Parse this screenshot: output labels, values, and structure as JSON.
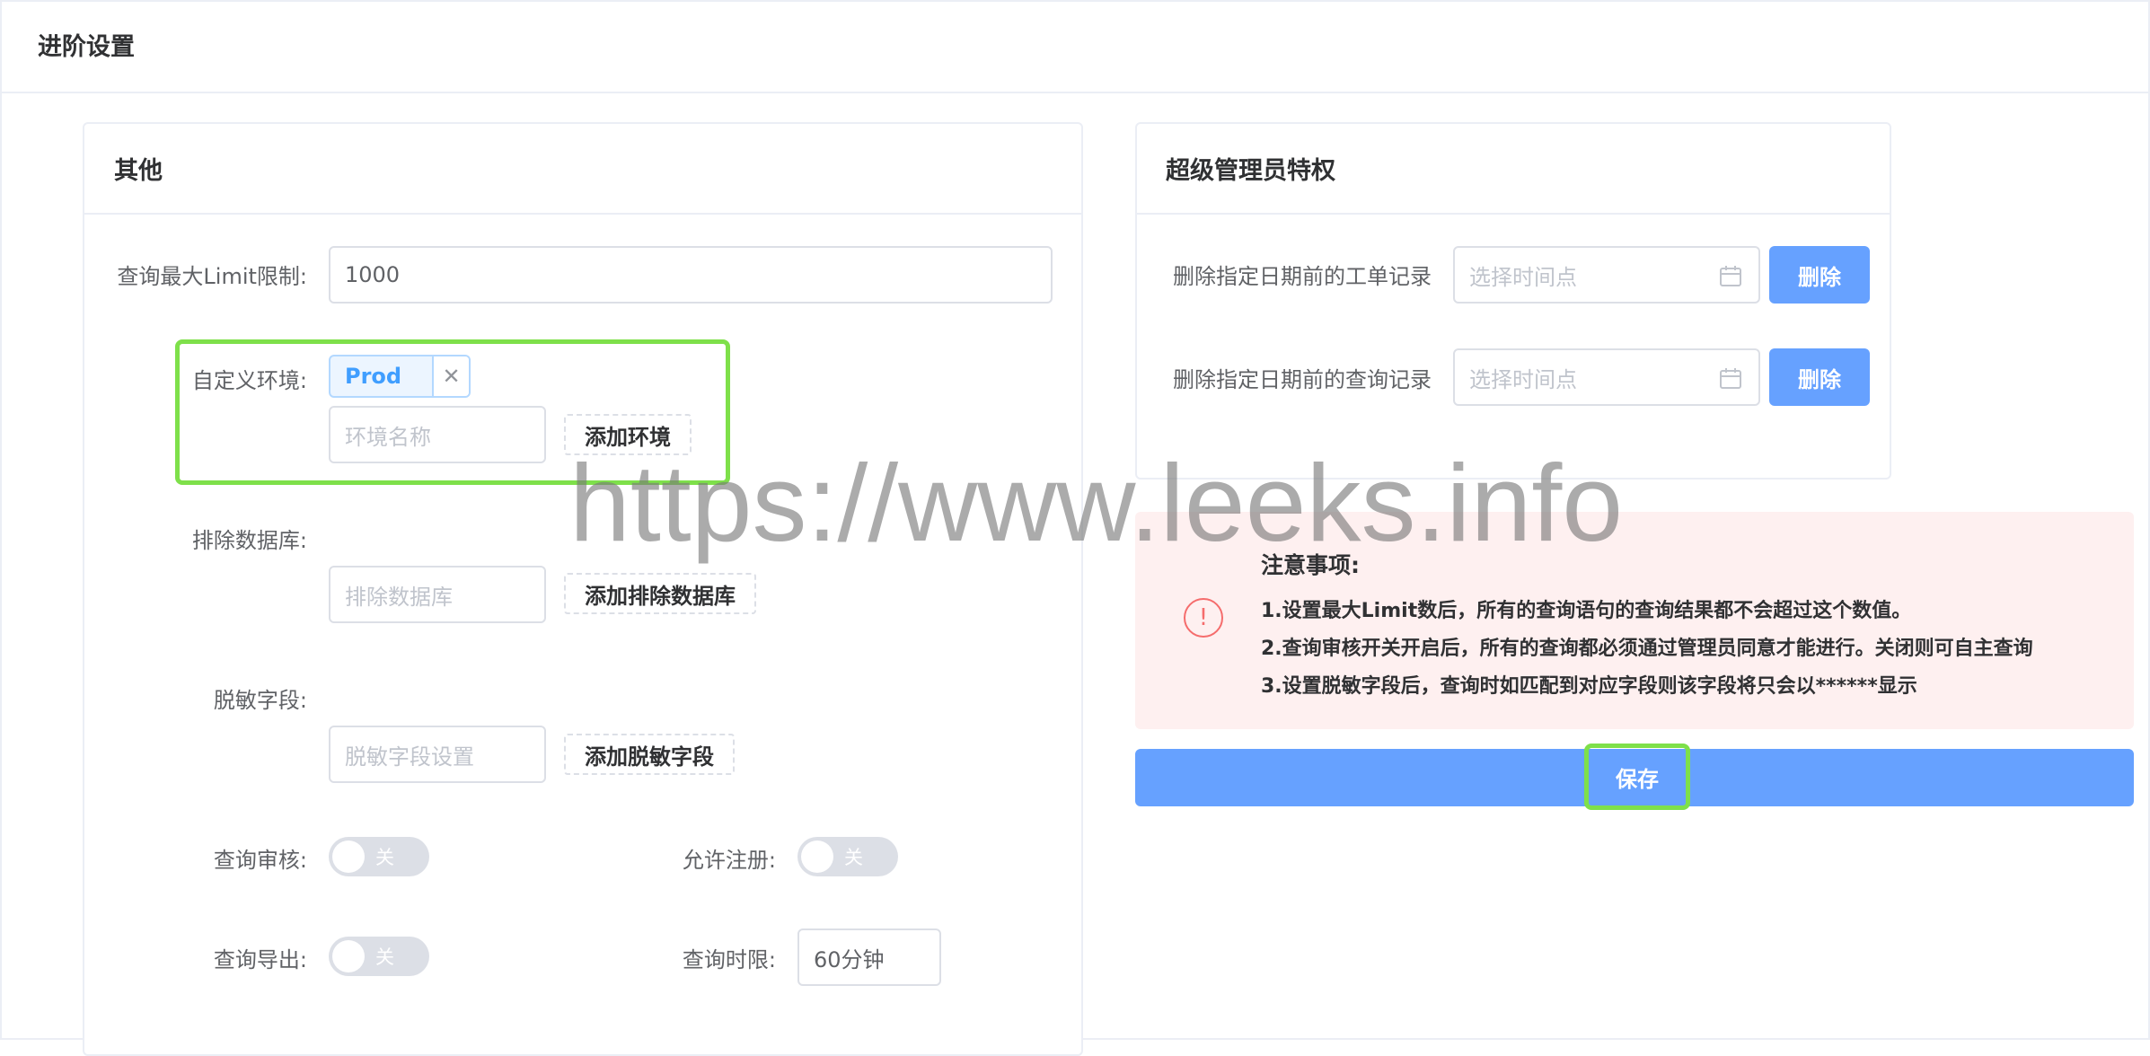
{
  "page": {
    "title": "进阶设置"
  },
  "other": {
    "title": "其他",
    "limit_label": "查询最大Limit限制:",
    "limit_value": "1000",
    "env_label": "自定义环境:",
    "env_tag": "Prod",
    "env_close_glyph": "✕",
    "env_placeholder": "环境名称",
    "env_add_button": "添加环境",
    "exclude_db_label": "排除数据库:",
    "exclude_db_placeholder": "排除数据库",
    "exclude_db_add_button": "添加排除数据库",
    "mask_label": "脱敏字段:",
    "mask_placeholder": "脱敏字段设置",
    "mask_add_button": "添加脱敏字段",
    "audit_label": "查询审核:",
    "audit_state": "关",
    "register_label": "允许注册:",
    "register_state": "关",
    "export_label": "查询导出:",
    "export_state": "关",
    "timeout_label": "查询时限:",
    "timeout_value": "60分钟"
  },
  "admin": {
    "title": "超级管理员特权",
    "rows": [
      {
        "label": "删除指定日期前的工单记录",
        "placeholder": "选择时间点",
        "button": "删除"
      },
      {
        "label": "删除指定日期前的查询记录",
        "placeholder": "选择时间点",
        "button": "删除"
      }
    ]
  },
  "notice": {
    "icon_glyph": "!",
    "title": "注意事项:",
    "lines": [
      "1.设置最大Limit数后，所有的查询语句的查询结果都不会超过这个数值。",
      "2.查询审核开关开启后，所有的查询都必须通过管理员同意才能进行。关闭则可自主查询",
      "3.设置脱敏字段后，查询时如匹配到对应字段则该字段将只会以******显示"
    ]
  },
  "save_button": "保存",
  "watermark": "https://www.leeks.info",
  "icons": {
    "calendar": "calendar-icon",
    "close": "close-icon",
    "warning": "warning-circle-icon"
  },
  "colors": {
    "primary": "#66a1ff",
    "highlight": "#7ee04a",
    "alert_bg": "#fef0f0",
    "alert_icon": "#f56c6c",
    "tag": "#409eff"
  }
}
